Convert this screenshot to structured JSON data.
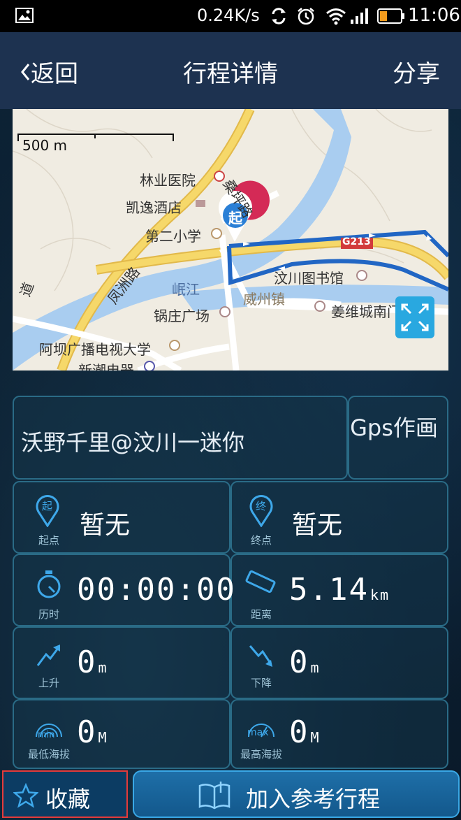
{
  "status_bar": {
    "net_speed": "0.24K/s",
    "time": "11:06"
  },
  "header": {
    "back_label": "返回",
    "title": "行程详情",
    "share_label": "分享"
  },
  "map": {
    "scale": "500 m",
    "labels": {
      "forestry_hospital": "林业医院",
      "kaiyi_hotel": "凯逸酒店",
      "second_primary": "第二小学",
      "sangping_road": "桑坪路",
      "fengzhou_road": "凤洲路",
      "minjiang": "岷江",
      "weizhou_town": "威州镇",
      "wenchuan_library": "汶川图书馆",
      "guozhuang_square": "锅庄广场",
      "jiangwei_city": "姜维城南门",
      "aba_tv_univ": "阿坝广播电视大学",
      "xinchao": "新潮电器",
      "g213": "G213",
      "dao": "道"
    },
    "start_marker": "起"
  },
  "trip": {
    "name": "沃野千里@汶川一迷你",
    "source": "Gps作画"
  },
  "stats": {
    "start": {
      "icon_char": "起",
      "caption": "起点",
      "value": "暂无"
    },
    "end": {
      "icon_char": "终",
      "caption": "终点",
      "value": "暂无"
    },
    "duration": {
      "caption": "历时",
      "value": "00:00:00"
    },
    "distance": {
      "caption": "距离",
      "value": "5.14",
      "unit": "km"
    },
    "ascent": {
      "caption": "上升",
      "value": "0",
      "unit": "m"
    },
    "descent": {
      "caption": "下降",
      "value": "0",
      "unit": "m"
    },
    "min_alt": {
      "caption": "最低海拔",
      "icon_text": "min",
      "value": "0",
      "unit": "M"
    },
    "max_alt": {
      "caption": "最高海拔",
      "icon_text": "max",
      "value": "0",
      "unit": "M"
    }
  },
  "bottom": {
    "favorite_label": "收藏",
    "add_label": "加入参考行程"
  }
}
